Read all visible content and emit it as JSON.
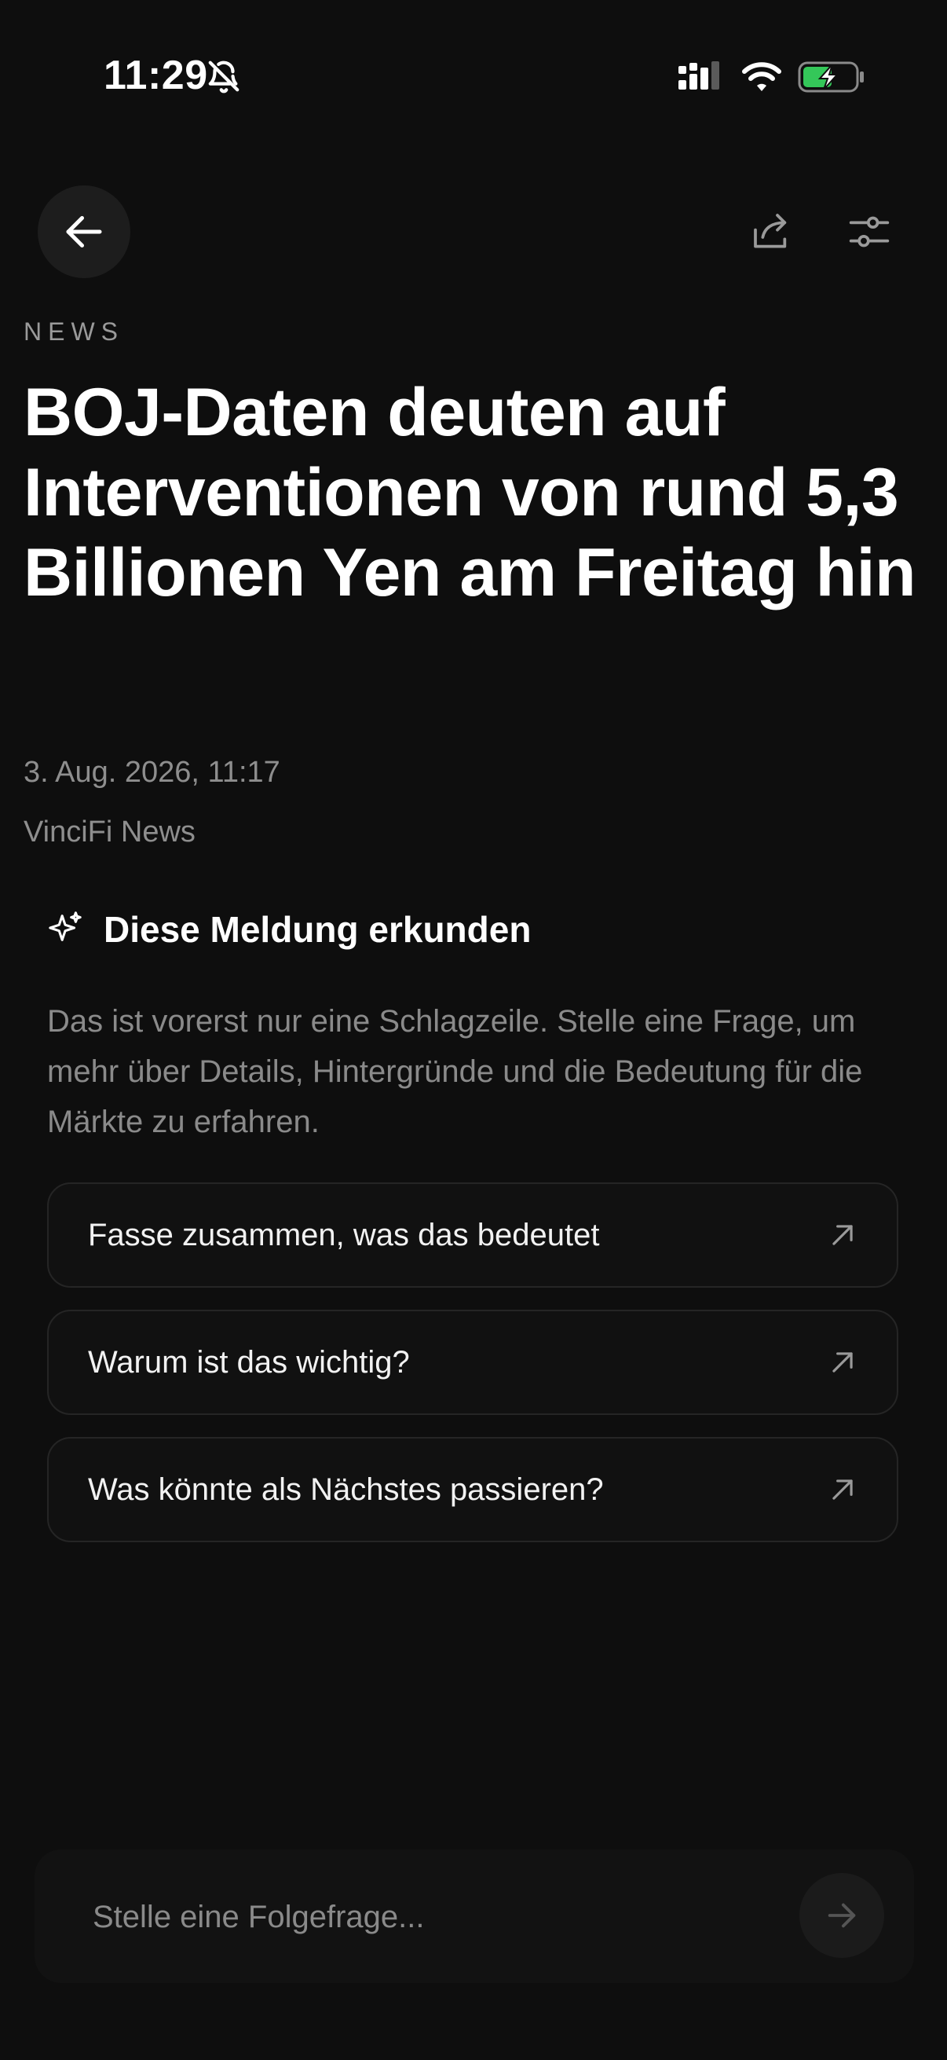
{
  "status_bar": {
    "time": "11:29",
    "icons": [
      "bell-slash-icon",
      "signal-icon",
      "wifi-icon",
      "battery-charging-icon"
    ],
    "battery_color": "#34c759"
  },
  "nav": {
    "back_icon": "arrow-left-icon",
    "share_icon": "share-icon",
    "filter_icon": "sliders-icon"
  },
  "article": {
    "section": "NEWS",
    "headline": "BOJ-Daten deuten auf Interventionen von rund 5,3 Billionen Yen am Freitag hin",
    "date": "3. Aug. 2026, 11:17",
    "source": "VinciFi News"
  },
  "explore": {
    "icon": "sparkle-icon",
    "title": "Diese Meldung erkunden",
    "description": "Das ist vorerst nur eine Schlagzeile. Stelle eine Frage, um mehr über Details, Hintergründe und die Bedeutung für die Märkte zu erfahren.",
    "suggestions": [
      {
        "label": "Fasse zusammen, was das bedeutet"
      },
      {
        "label": "Warum ist das wichtig?"
      },
      {
        "label": "Was könnte als Nächstes passieren?"
      }
    ]
  },
  "ask": {
    "placeholder": "Stelle eine Folgefrage...",
    "send_icon": "arrow-right-icon"
  }
}
